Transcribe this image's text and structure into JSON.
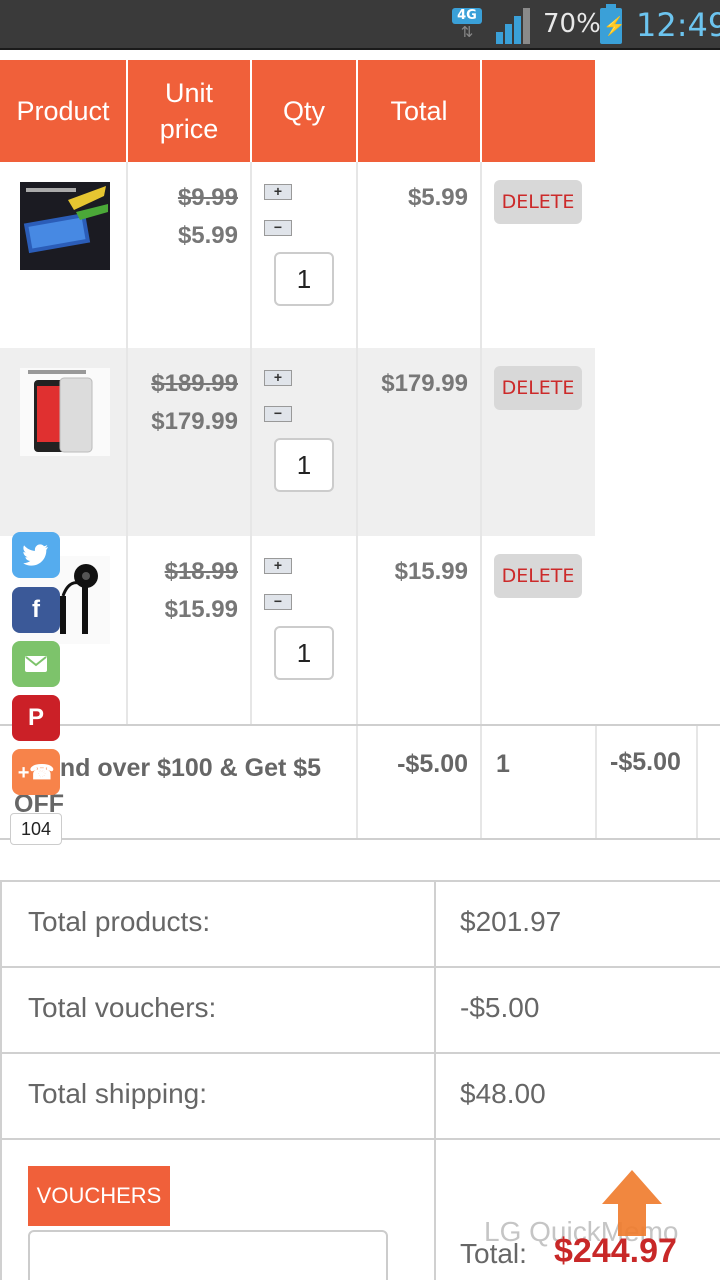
{
  "status_bar": {
    "network": "4G",
    "battery": "70%",
    "time": "12:49"
  },
  "cart": {
    "headers": {
      "product": "Product",
      "unit_price": "Unit price",
      "qty": "Qty",
      "total": "Total"
    },
    "items": [
      {
        "image": "screen-protector-thumbnail",
        "old_price": "$9.99",
        "price": "$5.99",
        "qty": "1",
        "total": "$5.99",
        "delete_label": "DELETE"
      },
      {
        "image": "smartphone-thumbnail",
        "old_price": "$189.99",
        "price": "$179.99",
        "qty": "1",
        "total": "$179.99",
        "delete_label": "DELETE"
      },
      {
        "image": "earphones-thumbnail",
        "old_price": "$18.99",
        "price": "$15.99",
        "qty": "1",
        "total": "$15.99",
        "delete_label": "DELETE"
      }
    ],
    "voucher_row": {
      "name": "Spend over $100 & Get $5 OFF",
      "unit_price": "-$5.00",
      "qty": "1",
      "total": "-$5.00"
    }
  },
  "totals": {
    "products_label": "Total products:",
    "products_value": "$201.97",
    "vouchers_label": "Total vouchers:",
    "vouchers_value": "-$5.00",
    "shipping_label": "Total shipping:",
    "shipping_value": "$48.00",
    "voucher_button": "VOUCHERS",
    "grand_label": "Total:",
    "grand_value": "$244.97"
  },
  "watermark": "LG QuickMemo",
  "share_bar": {
    "count": "104",
    "buttons": [
      "twitter-icon",
      "facebook-icon",
      "email-icon",
      "pinterest-icon",
      "share-plus-icon"
    ],
    "colors": {
      "twitter": "#55acee",
      "facebook": "#3b5998",
      "email": "#7dc36b",
      "pinterest": "#cb2027",
      "more": "#f7834a"
    }
  },
  "colors": {
    "accent": "#f0603a",
    "grand_total": "#c82828",
    "delete_text": "#cc2a2a",
    "status_time": "#6cc4ef"
  }
}
